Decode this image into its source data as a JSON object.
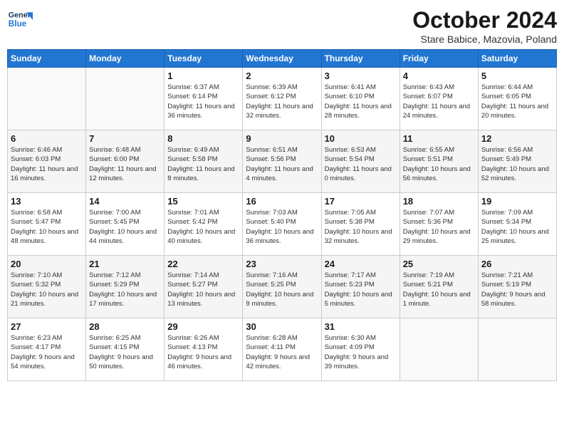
{
  "header": {
    "logo_line1": "General",
    "logo_line2": "Blue",
    "month": "October 2024",
    "location": "Stare Babice, Mazovia, Poland"
  },
  "weekdays": [
    "Sunday",
    "Monday",
    "Tuesday",
    "Wednesday",
    "Thursday",
    "Friday",
    "Saturday"
  ],
  "weeks": [
    [
      {
        "day": "",
        "info": ""
      },
      {
        "day": "",
        "info": ""
      },
      {
        "day": "1",
        "info": "Sunrise: 6:37 AM\nSunset: 6:14 PM\nDaylight: 11 hours\nand 36 minutes."
      },
      {
        "day": "2",
        "info": "Sunrise: 6:39 AM\nSunset: 6:12 PM\nDaylight: 11 hours\nand 32 minutes."
      },
      {
        "day": "3",
        "info": "Sunrise: 6:41 AM\nSunset: 6:10 PM\nDaylight: 11 hours\nand 28 minutes."
      },
      {
        "day": "4",
        "info": "Sunrise: 6:43 AM\nSunset: 6:07 PM\nDaylight: 11 hours\nand 24 minutes."
      },
      {
        "day": "5",
        "info": "Sunrise: 6:44 AM\nSunset: 6:05 PM\nDaylight: 11 hours\nand 20 minutes."
      }
    ],
    [
      {
        "day": "6",
        "info": "Sunrise: 6:46 AM\nSunset: 6:03 PM\nDaylight: 11 hours\nand 16 minutes."
      },
      {
        "day": "7",
        "info": "Sunrise: 6:48 AM\nSunset: 6:00 PM\nDaylight: 11 hours\nand 12 minutes."
      },
      {
        "day": "8",
        "info": "Sunrise: 6:49 AM\nSunset: 5:58 PM\nDaylight: 11 hours\nand 8 minutes."
      },
      {
        "day": "9",
        "info": "Sunrise: 6:51 AM\nSunset: 5:56 PM\nDaylight: 11 hours\nand 4 minutes."
      },
      {
        "day": "10",
        "info": "Sunrise: 6:53 AM\nSunset: 5:54 PM\nDaylight: 11 hours\nand 0 minutes."
      },
      {
        "day": "11",
        "info": "Sunrise: 6:55 AM\nSunset: 5:51 PM\nDaylight: 10 hours\nand 56 minutes."
      },
      {
        "day": "12",
        "info": "Sunrise: 6:56 AM\nSunset: 5:49 PM\nDaylight: 10 hours\nand 52 minutes."
      }
    ],
    [
      {
        "day": "13",
        "info": "Sunrise: 6:58 AM\nSunset: 5:47 PM\nDaylight: 10 hours\nand 48 minutes."
      },
      {
        "day": "14",
        "info": "Sunrise: 7:00 AM\nSunset: 5:45 PM\nDaylight: 10 hours\nand 44 minutes."
      },
      {
        "day": "15",
        "info": "Sunrise: 7:01 AM\nSunset: 5:42 PM\nDaylight: 10 hours\nand 40 minutes."
      },
      {
        "day": "16",
        "info": "Sunrise: 7:03 AM\nSunset: 5:40 PM\nDaylight: 10 hours\nand 36 minutes."
      },
      {
        "day": "17",
        "info": "Sunrise: 7:05 AM\nSunset: 5:38 PM\nDaylight: 10 hours\nand 32 minutes."
      },
      {
        "day": "18",
        "info": "Sunrise: 7:07 AM\nSunset: 5:36 PM\nDaylight: 10 hours\nand 29 minutes."
      },
      {
        "day": "19",
        "info": "Sunrise: 7:09 AM\nSunset: 5:34 PM\nDaylight: 10 hours\nand 25 minutes."
      }
    ],
    [
      {
        "day": "20",
        "info": "Sunrise: 7:10 AM\nSunset: 5:32 PM\nDaylight: 10 hours\nand 21 minutes."
      },
      {
        "day": "21",
        "info": "Sunrise: 7:12 AM\nSunset: 5:29 PM\nDaylight: 10 hours\nand 17 minutes."
      },
      {
        "day": "22",
        "info": "Sunrise: 7:14 AM\nSunset: 5:27 PM\nDaylight: 10 hours\nand 13 minutes."
      },
      {
        "day": "23",
        "info": "Sunrise: 7:16 AM\nSunset: 5:25 PM\nDaylight: 10 hours\nand 9 minutes."
      },
      {
        "day": "24",
        "info": "Sunrise: 7:17 AM\nSunset: 5:23 PM\nDaylight: 10 hours\nand 5 minutes."
      },
      {
        "day": "25",
        "info": "Sunrise: 7:19 AM\nSunset: 5:21 PM\nDaylight: 10 hours\nand 1 minute."
      },
      {
        "day": "26",
        "info": "Sunrise: 7:21 AM\nSunset: 5:19 PM\nDaylight: 9 hours\nand 58 minutes."
      }
    ],
    [
      {
        "day": "27",
        "info": "Sunrise: 6:23 AM\nSunset: 4:17 PM\nDaylight: 9 hours\nand 54 minutes."
      },
      {
        "day": "28",
        "info": "Sunrise: 6:25 AM\nSunset: 4:15 PM\nDaylight: 9 hours\nand 50 minutes."
      },
      {
        "day": "29",
        "info": "Sunrise: 6:26 AM\nSunset: 4:13 PM\nDaylight: 9 hours\nand 46 minutes."
      },
      {
        "day": "30",
        "info": "Sunrise: 6:28 AM\nSunset: 4:11 PM\nDaylight: 9 hours\nand 42 minutes."
      },
      {
        "day": "31",
        "info": "Sunrise: 6:30 AM\nSunset: 4:09 PM\nDaylight: 9 hours\nand 39 minutes."
      },
      {
        "day": "",
        "info": ""
      },
      {
        "day": "",
        "info": ""
      }
    ]
  ]
}
